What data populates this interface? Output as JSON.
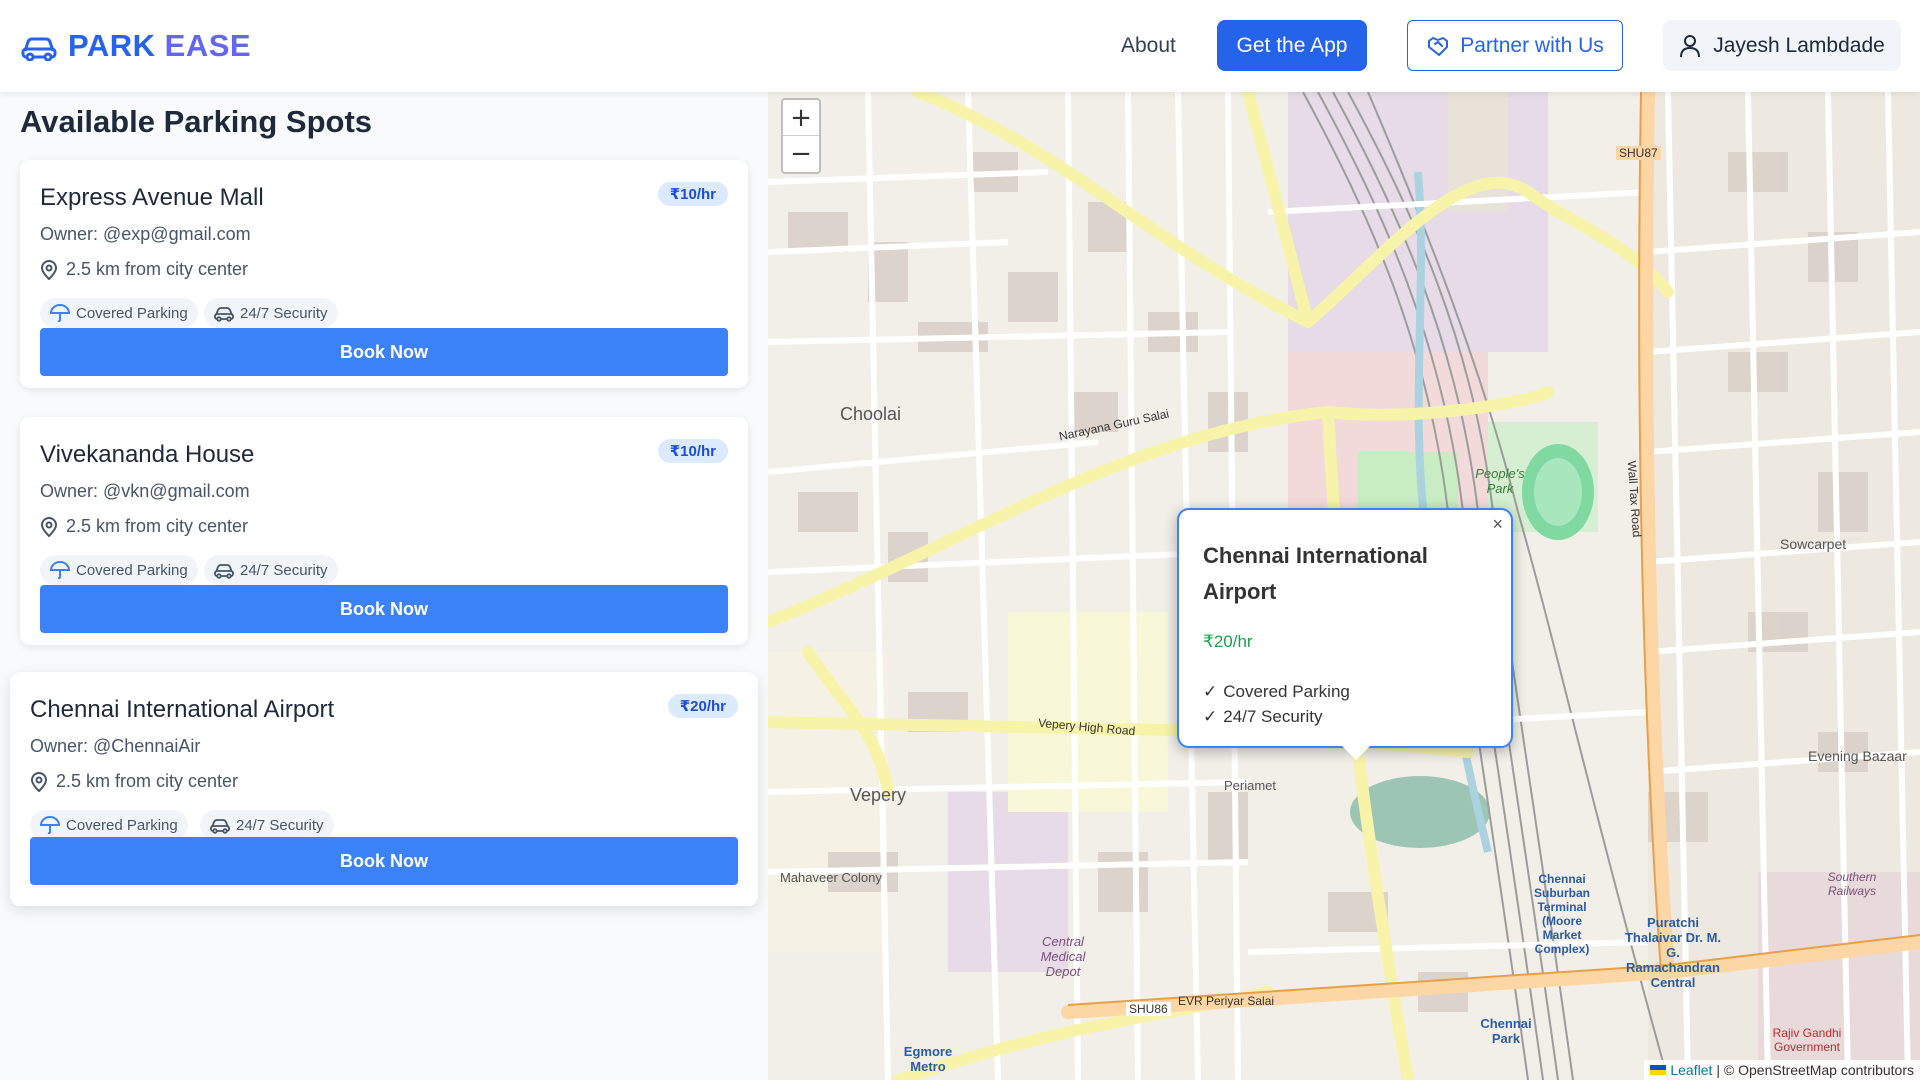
{
  "header": {
    "logo_park": "PARK",
    "logo_ease": "EASE",
    "about": "About",
    "get_app": "Get the App",
    "partner": "Partner with Us",
    "user_name": "Jayesh Lambdade"
  },
  "panel": {
    "title": "Available Parking Spots",
    "spots": [
      {
        "name": "Express Avenue Mall",
        "owner": "Owner: @exp@gmail.com",
        "distance": "2.5 km from city center",
        "price": "₹10/hr",
        "tag1": "Covered Parking",
        "tag2": "24/7 Security",
        "book": "Book Now"
      },
      {
        "name": "Vivekananda House",
        "owner": "Owner: @vkn@gmail.com",
        "distance": "2.5 km from city center",
        "price": "₹10/hr",
        "tag1": "Covered Parking",
        "tag2": "24/7 Security",
        "book": "Book Now"
      },
      {
        "name": "Chennai International Airport",
        "owner": "Owner: @ChennaiAir",
        "distance": "2.5 km from city center",
        "price": "₹20/hr",
        "tag1": "Covered Parking",
        "tag2": "24/7 Security",
        "book": "Book Now"
      }
    ]
  },
  "map": {
    "zoom_in": "+",
    "zoom_out": "−",
    "attribution_leaflet": "Leaflet",
    "attribution_rest": "| © OpenStreetMap contributors",
    "popup": {
      "close": "×",
      "title": "Chennai International Airport",
      "price": "₹20/hr",
      "feature1": "Covered Parking",
      "feature2": "24/7 Security"
    },
    "labels": {
      "choolai": "Choolai",
      "vepery": "Vepery",
      "peoples_park": "People's Park",
      "central_medical": "Central Medical Depot",
      "chennai_suburban": "Chennai Suburban Terminal (Moore Market Complex)",
      "puratchi": "Puratchi Thalaivar Dr. M. G. Ramachandran Central",
      "egmore": "Egmore Metro",
      "chennai_park": "Chennai Park",
      "sowcarpet": "Sowcarpet",
      "evening_bazaar": "Evening Bazaar",
      "narayana_guru": "Narayana Guru Salai",
      "vepery_high": "Vepery High Road",
      "evr_periyar": "EVR Periyar Salai",
      "wall_tax": "Wall Tax Road",
      "mahaveer": "Mahaveer Colony",
      "southern_railways": "Southern Railways",
      "shu87": "SHU87",
      "shu86": "SHU86",
      "periamet": "Periamet",
      "rajiv_gandhi": "Rajiv Gandhi Government"
    }
  },
  "colors": {
    "primary": "#2563eb",
    "accent": "#6366f1",
    "book_button": "#3b82f6",
    "price_green": "#16a34a",
    "badge_bg": "#dbeafe"
  }
}
